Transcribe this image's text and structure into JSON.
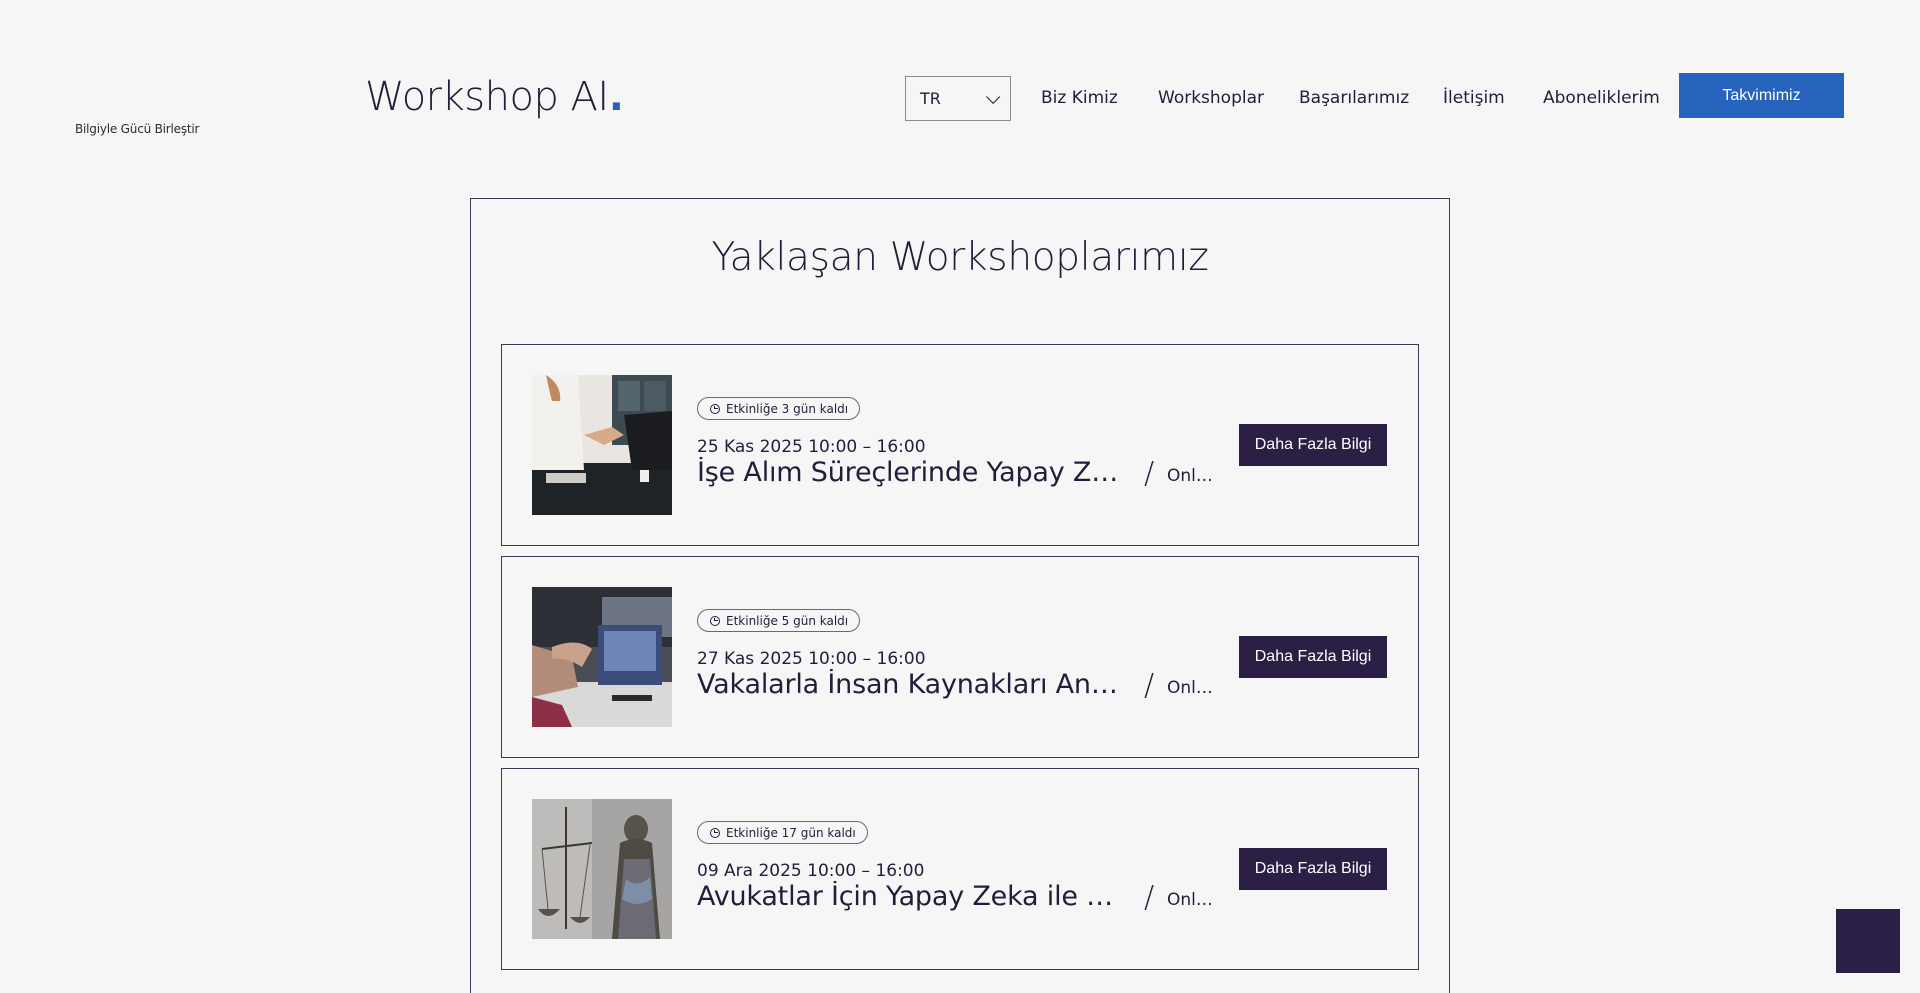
{
  "header": {
    "tagline": "Bilgiyle Gücü Birleştir",
    "logo_text": "Workshop AI",
    "logo_dot": ".",
    "language": "TR",
    "nav": [
      "Biz Kimiz",
      "Workshoplar",
      "Başarılarımız",
      "İletişim",
      "Aboneliklerim"
    ],
    "cta_label": "Takvimimiz"
  },
  "main": {
    "heading": "Yaklaşan Workshoplarımız",
    "events": [
      {
        "countdown": "Etkinliğe 3 gün kaldı",
        "date": "25 Kas 2025 10:00 – 16:00",
        "title": "İşe Alım Süreçlerinde Yapay Zeka ile Dönüşüm",
        "separator": "/",
        "location": "Online",
        "button": "Daha Fazla Bilgi",
        "image": "handshake-photo"
      },
      {
        "countdown": "Etkinliğe 5 gün kaldı",
        "date": "27 Kas 2025 10:00 – 16:00",
        "title": "Vakalarla İnsan Kaynakları Analitiği Workshop",
        "separator": "/",
        "location": "Online",
        "button": "Daha Fazla Bilgi",
        "image": "meeting-laptop-photo"
      },
      {
        "countdown": "Etkinliğe 17 gün kaldı",
        "date": "09 Ara 2025 10:00 – 16:00",
        "title": "Avukatlar İçin Yapay Zeka ile Daha Verimli Çalışma",
        "separator": "/",
        "location": "Online",
        "button": "Daha Fazla Bilgi",
        "image": "lady-justice-statue-photo"
      }
    ]
  },
  "colors": {
    "background": "#f6f6f7",
    "primary_text": "#231d3a",
    "accent_blue": "#2563bd",
    "button_dark": "#2b1f45"
  }
}
